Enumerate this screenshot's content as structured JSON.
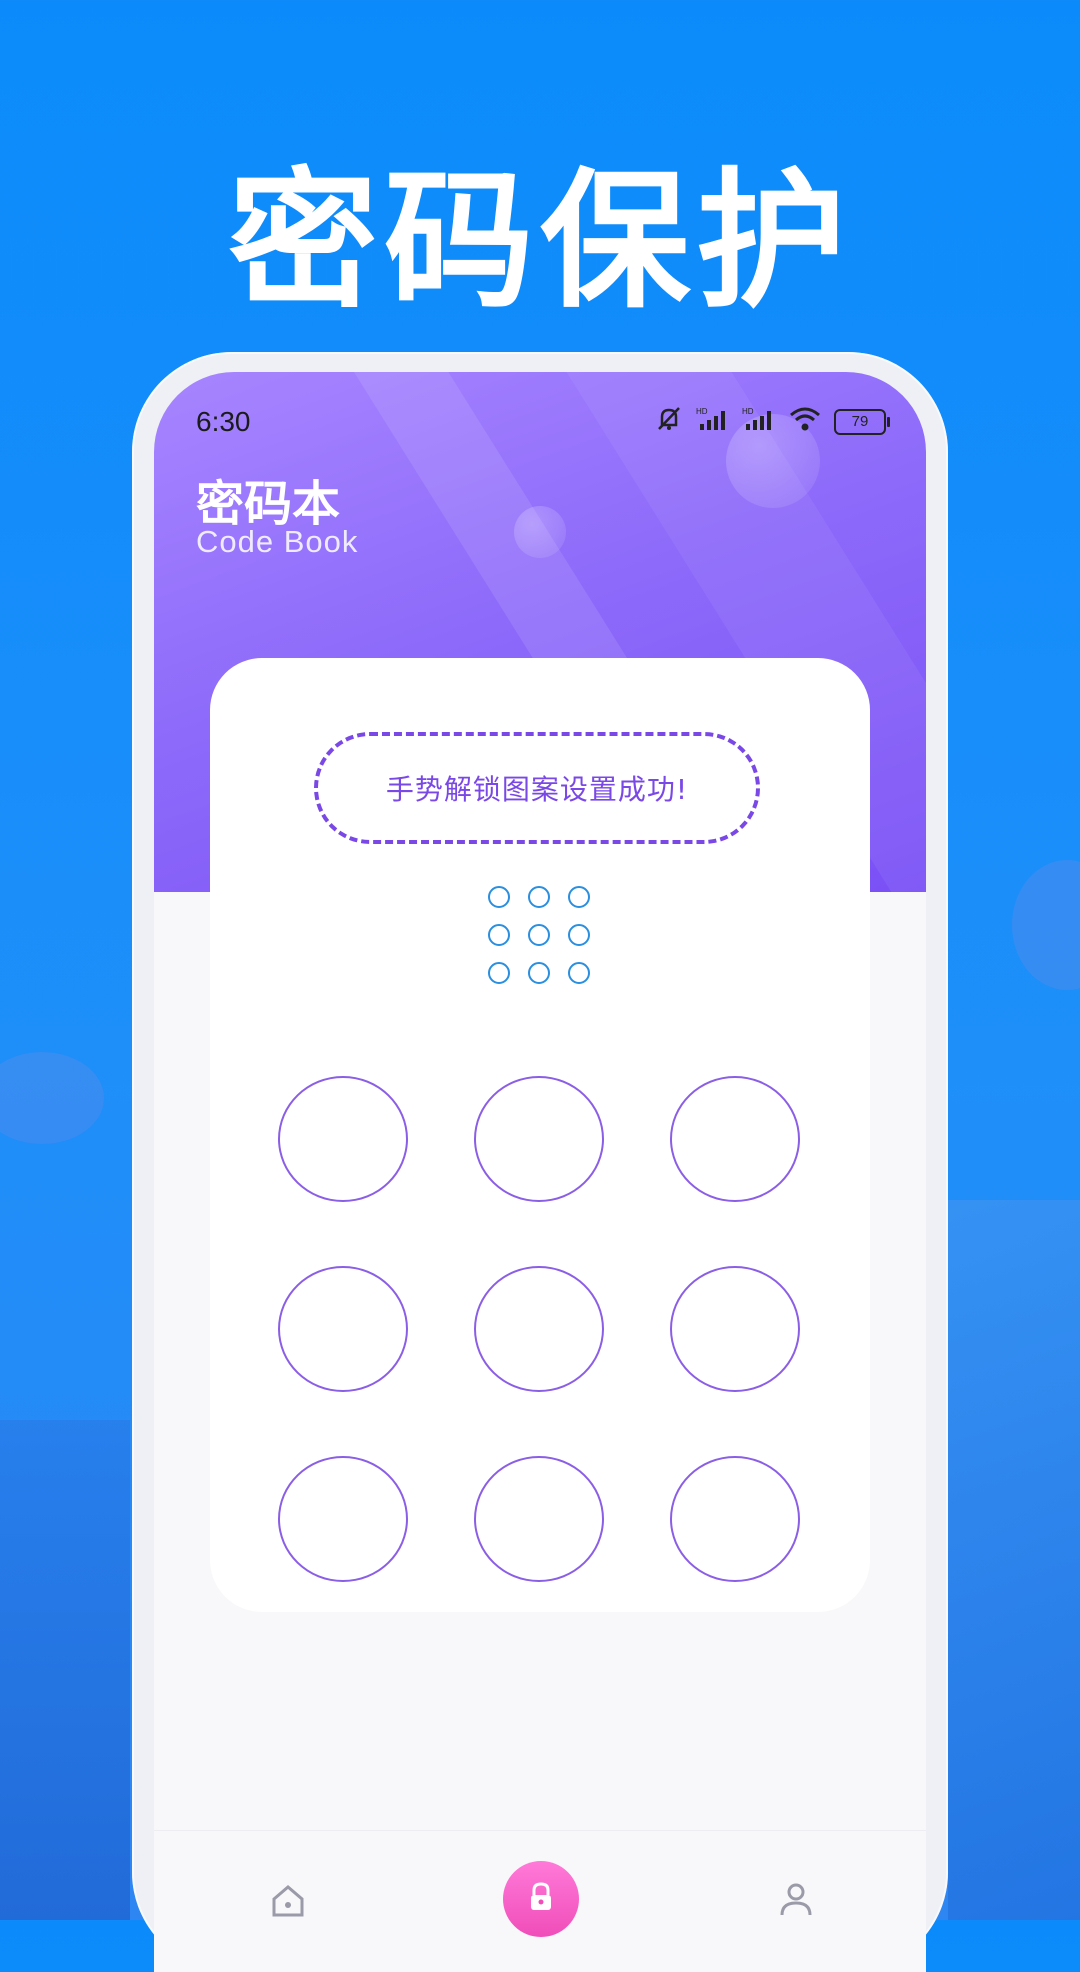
{
  "headline": "密码保护",
  "status_bar": {
    "time": "6:30",
    "battery": "79",
    "icons": [
      "mute-icon",
      "hd-signal-icon",
      "hd-signal-icon",
      "wifi-icon",
      "battery-icon"
    ]
  },
  "app": {
    "title": "密码本",
    "subtitle": "Code Book"
  },
  "gesture": {
    "message": "手势解锁图案设置成功!",
    "preview_grid": "3x3",
    "pad_grid": "3x3"
  },
  "tabbar": {
    "items": [
      {
        "icon": "home-icon"
      },
      {
        "icon": "lock-icon",
        "active": true
      },
      {
        "icon": "user-icon"
      }
    ]
  },
  "colors": {
    "background": "#0B8BFB",
    "header_gradient_start": "#A785FF",
    "header_gradient_end": "#7A50F6",
    "accent_purple": "#7A48E6",
    "preview_blue": "#2A8FE0",
    "tab_active": "#F04DB9"
  }
}
